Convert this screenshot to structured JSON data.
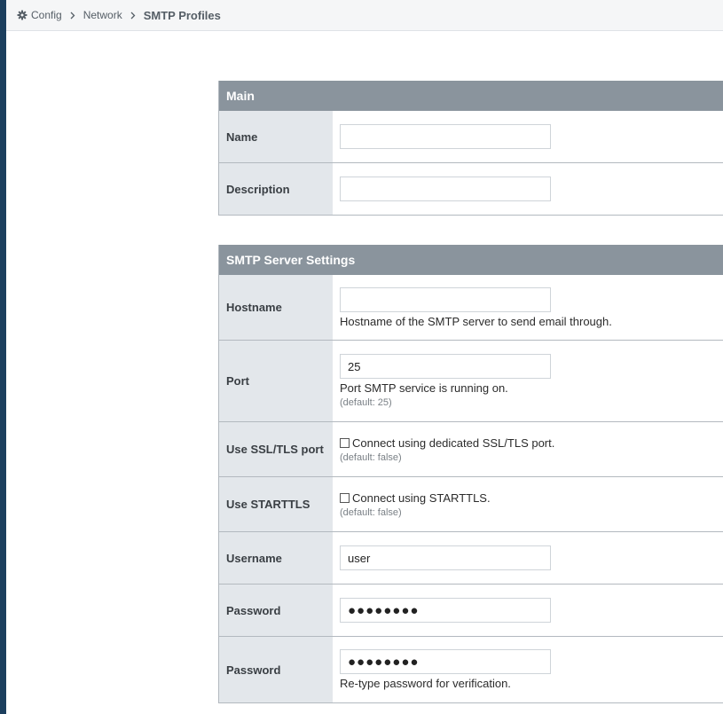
{
  "breadcrumb": {
    "icon": "gear-icon",
    "items": [
      "Config",
      "Network"
    ],
    "current": "SMTP Profiles"
  },
  "main_section": {
    "title": "Main",
    "name_label": "Name",
    "name_value": "",
    "description_label": "Description",
    "description_value": ""
  },
  "smtp_section": {
    "title": "SMTP Server Settings",
    "hostname": {
      "label": "Hostname",
      "value": "",
      "help": "Hostname of the SMTP server to send email through."
    },
    "port": {
      "label": "Port",
      "value": "25",
      "help": "Port SMTP service is running on.",
      "default": "(default: 25)"
    },
    "ssl": {
      "label": "Use SSL/TLS port",
      "checkbox_label": "Connect using dedicated SSL/TLS port.",
      "checked": false,
      "default": "(default: false)"
    },
    "starttls": {
      "label": "Use STARTTLS",
      "checkbox_label": "Connect using STARTTLS.",
      "checked": false,
      "default": "(default: false)"
    },
    "username": {
      "label": "Username",
      "value": "user"
    },
    "password": {
      "label": "Password",
      "value": "●●●●●●●●"
    },
    "password_verify": {
      "label": "Password",
      "value": "●●●●●●●●",
      "help": "Re-type password for verification."
    }
  },
  "colors": {
    "sidebar": "#1c3f5e",
    "panel_header": "#8a949d",
    "label_background": "#e3e7eb"
  }
}
